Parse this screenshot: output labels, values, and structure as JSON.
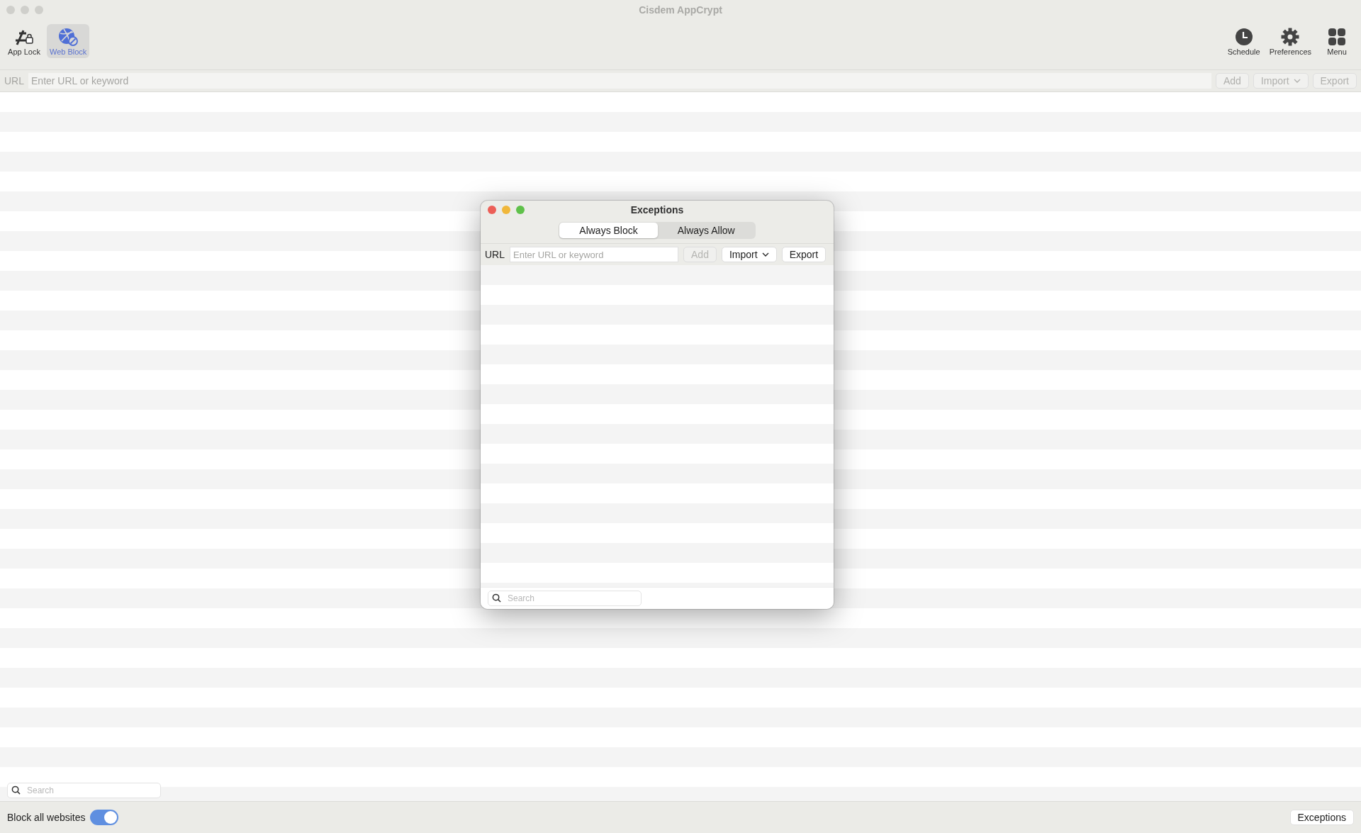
{
  "window": {
    "title": "Cisdem AppCrypt"
  },
  "toolbar": {
    "left": [
      {
        "label": "App Lock",
        "kind": "applock",
        "selected": false
      },
      {
        "label": "Web Block",
        "kind": "globe",
        "selected": true
      }
    ],
    "right": [
      {
        "label": "Schedule",
        "kind": "clock"
      },
      {
        "label": "Preferences",
        "kind": "gear"
      },
      {
        "label": "Menu",
        "kind": "grid"
      }
    ]
  },
  "url_bar": {
    "label": "URL",
    "placeholder": "Enter URL or keyword",
    "buttons": [
      {
        "label": "Add",
        "kind": "plain"
      },
      {
        "label": "Import",
        "kind": "menu"
      },
      {
        "label": "Export",
        "kind": "plain"
      }
    ]
  },
  "search": {
    "placeholder": "Search"
  },
  "footer": {
    "toggle": {
      "label": "Block all websites",
      "on": true
    },
    "button": "Exceptions"
  },
  "dialog": {
    "title": "Exceptions",
    "segments": [
      {
        "label": "Always Block",
        "selected": true
      },
      {
        "label": "Always Allow",
        "selected": false
      }
    ],
    "url_bar": {
      "label": "URL",
      "placeholder": "Enter URL or keyword",
      "buttons": [
        {
          "label": "Add",
          "kind": "plain",
          "disabled": true
        },
        {
          "label": "Import",
          "kind": "menu",
          "disabled": false
        },
        {
          "label": "Export",
          "kind": "plain",
          "disabled": false
        }
      ]
    },
    "search": {
      "placeholder": "Search"
    }
  }
}
